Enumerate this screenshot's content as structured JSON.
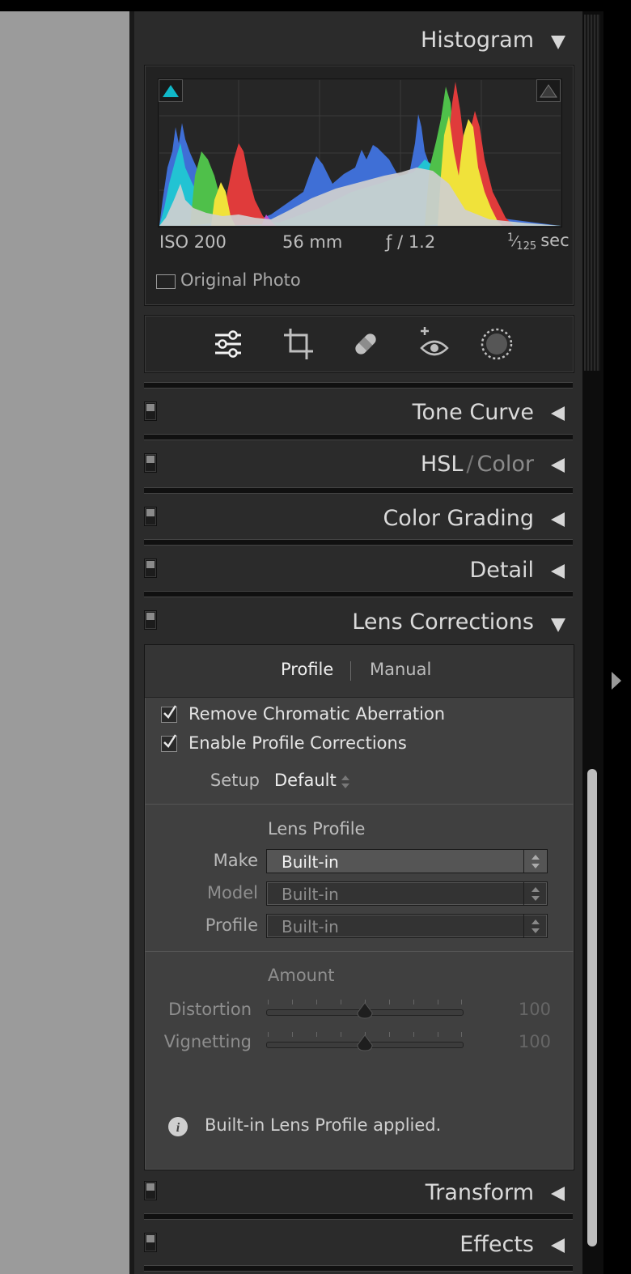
{
  "histogram": {
    "title": "Histogram",
    "info": {
      "iso": "ISO 200",
      "focal": "56 mm",
      "aperture": "ƒ / 1.2",
      "shutter_num": "1",
      "shutter_den": "125",
      "shutter_unit": "sec"
    },
    "original_photo_label": "Original Photo"
  },
  "tools": [
    "edit-sliders",
    "crop",
    "healing",
    "red-eye",
    "masking"
  ],
  "sections": {
    "tone_curve": "Tone Curve",
    "hsl": "HSL",
    "hsl_slash": "/",
    "color": "Color",
    "color_grading": "Color Grading",
    "detail": "Detail",
    "lens_corrections": "Lens Corrections",
    "transform": "Transform",
    "effects": "Effects"
  },
  "lens": {
    "tabs": {
      "profile": "Profile",
      "manual": "Manual"
    },
    "remove_ca": {
      "label": "Remove Chromatic Aberration",
      "checked": true
    },
    "enable_profile": {
      "label": "Enable Profile Corrections",
      "checked": true
    },
    "setup": {
      "label": "Setup",
      "value": "Default"
    },
    "lens_profile_heading": "Lens Profile",
    "make": {
      "label": "Make",
      "value": "Built-in"
    },
    "model": {
      "label": "Model",
      "value": "Built-in"
    },
    "profile": {
      "label": "Profile",
      "value": "Built-in"
    },
    "amount_heading": "Amount",
    "distortion": {
      "label": "Distortion",
      "value": "100"
    },
    "vignetting": {
      "label": "Vignetting",
      "value": "100"
    },
    "info_message": "Built-in Lens Profile applied."
  },
  "colors": {
    "clip_shadow": "#10b8c8",
    "panel": "#2b2b2b",
    "accent_text": "#dadada"
  }
}
